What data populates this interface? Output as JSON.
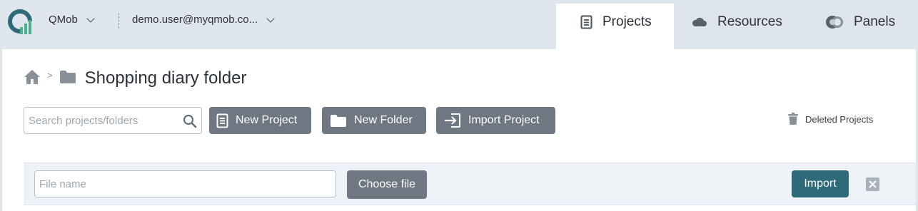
{
  "header": {
    "account_label": "QMob",
    "user_label": "demo.user@myqmob.co...",
    "tabs": [
      {
        "label": "Projects",
        "icon": "document-icon",
        "active": true
      },
      {
        "label": "Resources",
        "icon": "cloud-icon",
        "active": false
      },
      {
        "label": "Panels",
        "icon": "globe-icon",
        "active": false
      }
    ]
  },
  "breadcrumb": {
    "separator": ">",
    "current": "Shopping diary folder"
  },
  "toolbar": {
    "search_placeholder": "Search projects/folders",
    "new_project_label": "New Project",
    "new_folder_label": "New Folder",
    "import_project_label": "Import Project",
    "deleted_projects_label": "Deleted Projects"
  },
  "import_panel": {
    "file_name_placeholder": "File name",
    "choose_file_label": "Choose file",
    "import_label": "Import"
  },
  "colors": {
    "accent": "#2e6a7a",
    "button_gray": "#6f7782",
    "header_bg": "#dfe5ec"
  }
}
